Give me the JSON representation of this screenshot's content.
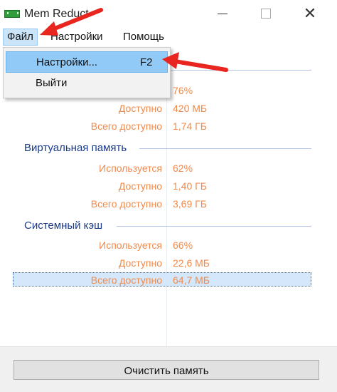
{
  "window": {
    "title": "Mem Reduct",
    "minimize_glyph": "—",
    "maximize_glyph": "",
    "close_glyph": "✕"
  },
  "menubar": {
    "file": "Файл",
    "settings": "Настройки",
    "help": "Помощь"
  },
  "file_menu": {
    "items": [
      {
        "label": "Настройки...",
        "shortcut": "F2"
      },
      {
        "label": "Выйти",
        "shortcut": ""
      }
    ]
  },
  "groups": [
    {
      "title": "",
      "rows": [
        {
          "label": "",
          "value": "76%"
        },
        {
          "label": "Доступно",
          "value": "420 МБ"
        },
        {
          "label": "Всего доступно",
          "value": "1,74 ГБ"
        }
      ]
    },
    {
      "title": "Виртуальная память",
      "rows": [
        {
          "label": "Используется",
          "value": "62%"
        },
        {
          "label": "Доступно",
          "value": "1,40 ГБ"
        },
        {
          "label": "Всего доступно",
          "value": "3,69 ГБ"
        }
      ]
    },
    {
      "title": "Системный кэш",
      "rows": [
        {
          "label": "Используется",
          "value": "66%"
        },
        {
          "label": "Доступно",
          "value": "22,6 МБ"
        },
        {
          "label": "Всего доступно",
          "value": "64,7 МБ"
        }
      ]
    }
  ],
  "bottom": {
    "clear_button": "Очистить память"
  },
  "colors": {
    "accent": "#f08a4b",
    "group_title": "#1a3a8a",
    "annotation_arrow": "#e8251e",
    "menu_highlight": "#91c9f7"
  },
  "icons": {
    "app": "memory-chip-icon",
    "annotation": "red-arrow-icon"
  }
}
